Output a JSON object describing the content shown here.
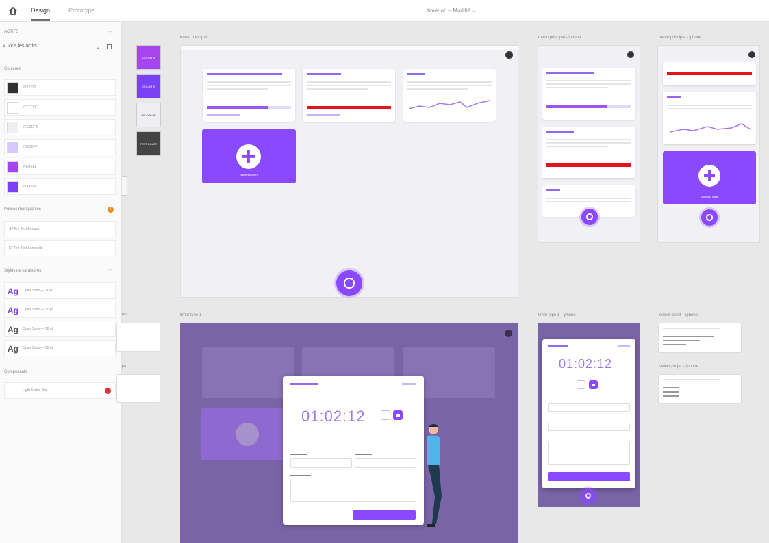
{
  "topbar": {
    "design_tab": "Design",
    "prototype_tab": "Prototype",
    "doc_title": "timerjob – Modifié ⌄"
  },
  "sidebar": {
    "assets_title": "ACTIFS",
    "assets_filter": "Tous les actifs",
    "colors_title": "Couleurs",
    "colors": [
      {
        "hex": "#323232",
        "label": "#323232"
      },
      {
        "hex": "#FFFFFF",
        "label": "#FFFFFF"
      },
      {
        "hex": "#EEEEF3",
        "label": "#EEEEF3"
      },
      {
        "hex": "#D3C8FF",
        "label": "#D3C8FF"
      },
      {
        "hex": "#A645EF",
        "label": "#A645EF"
      },
      {
        "hex": "#7A42F4",
        "label": "#7A42F4"
      }
    ],
    "fonts_title": "Polices manquantes",
    "fonts": [
      "SF Pro Text Regular",
      "SF Pro Text Semibold"
    ],
    "char_styles_title": "Styles de caractères",
    "char_styles": [
      "Open Sans — 11 pt",
      "Open Sans — 10 pt",
      "Open Sans — 10 pt",
      "Open Sans — 10 pt"
    ],
    "components_title": "Composants",
    "components": [
      "Light Status Bar"
    ]
  },
  "canvas": {
    "left_swatches": [
      "COLOR B",
      "COLOR B",
      "BG COLOR",
      "TEXT COLOR"
    ],
    "boards": {
      "menu_principal": "menu principal",
      "menu_iphone_1": "menu principal - iphone",
      "menu_iphone_2": "menu principal - iphone",
      "timer_type_1": "timer type 1",
      "timer_type_1_iphone": "timer type 1 - iphone",
      "select_client_iphone": "select client – iphone",
      "select_projet_iphone": "select projet – iphone",
      "client_fragment": "ent",
      "projet_fragment": "jet"
    },
    "timer_value": "01:02:12",
    "new_client": "Nouveau client"
  },
  "colors": {
    "accent": "#8a48ff",
    "red": "#e4141c"
  }
}
